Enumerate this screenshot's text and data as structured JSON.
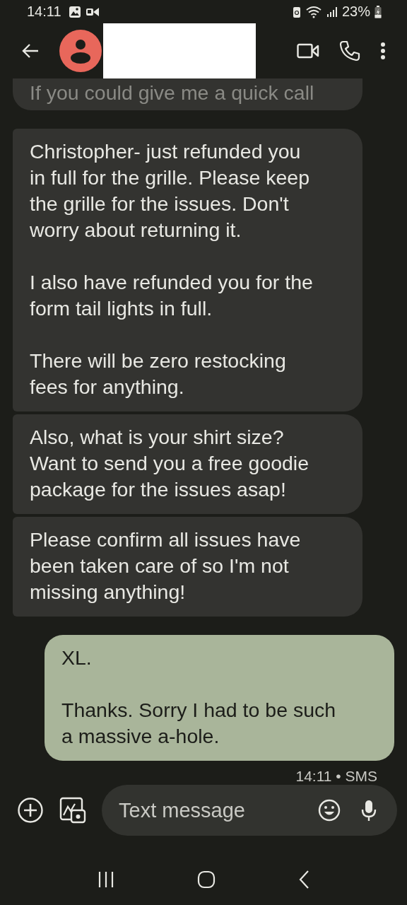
{
  "status_bar": {
    "time": "14:11",
    "battery": "23%"
  },
  "header": {
    "contact_name_redacted": true
  },
  "messages": [
    {
      "kind": "incoming",
      "text": "If you could give me a quick call",
      "cut": true
    },
    {
      "kind": "incoming",
      "text": "Christopher- just refunded you in full for the grille. Please keep the grille for the issues. Don't worry about returning it.\n\nI also have refunded you for the form tail lights in full.\n\nThere will be zero restocking fees for anything.",
      "cut": false
    },
    {
      "kind": "incoming",
      "text": "Also, what is your shirt size? Want to send you a free goodie package for the issues asap!",
      "cut": false
    },
    {
      "kind": "incoming",
      "text": "Please confirm all issues have been taken care of so I'm not missing anything!",
      "cut": false
    },
    {
      "kind": "outgoing",
      "text": "XL.\n\nThanks. Sorry I had to be such a massive a-hole.",
      "cut": false
    }
  ],
  "meta": "14:11 • SMS",
  "composer": {
    "placeholder": "Text message"
  }
}
